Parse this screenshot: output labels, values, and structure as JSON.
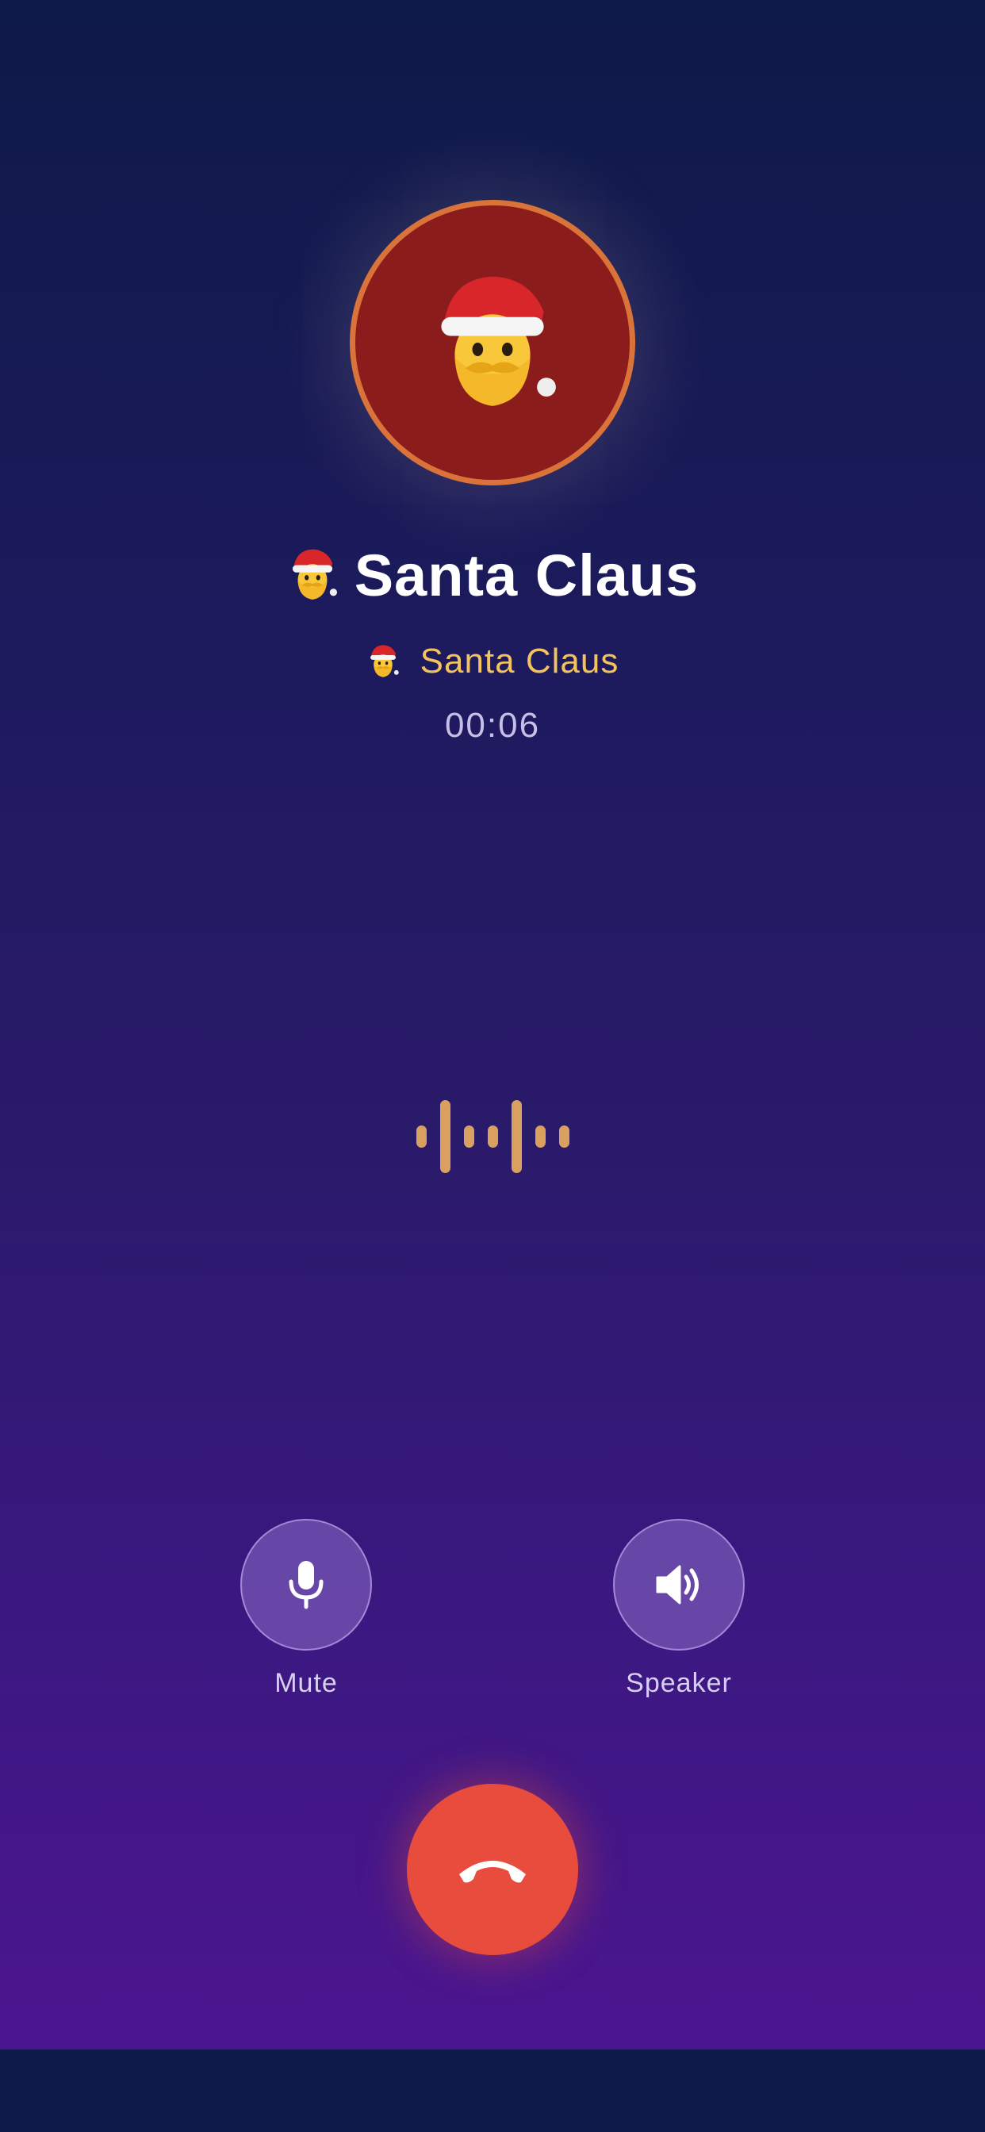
{
  "caller": {
    "name": "Santa Claus",
    "subtitle": "Santa Claus",
    "avatar_icon": "santa-claus-emoji-icon"
  },
  "call": {
    "duration": "00:06",
    "waveform_levels": [
      0.3,
      1.0,
      0.3,
      0.3,
      1.0,
      0.3,
      0.3
    ]
  },
  "controls": {
    "mute_label": "Mute",
    "mute_icon": "microphone-icon",
    "speaker_label": "Speaker",
    "speaker_icon": "speaker-icon",
    "end_call_icon": "phone-hangup-icon"
  },
  "colors": {
    "background_top": "#0e1a48",
    "background_bottom": "#4c1590",
    "avatar_fill": "#8b1c1c",
    "avatar_ring": "#d9733a",
    "subtitle_text": "#f3c35e",
    "waveform": "#d9a060",
    "end_call": "#e84c3d"
  }
}
